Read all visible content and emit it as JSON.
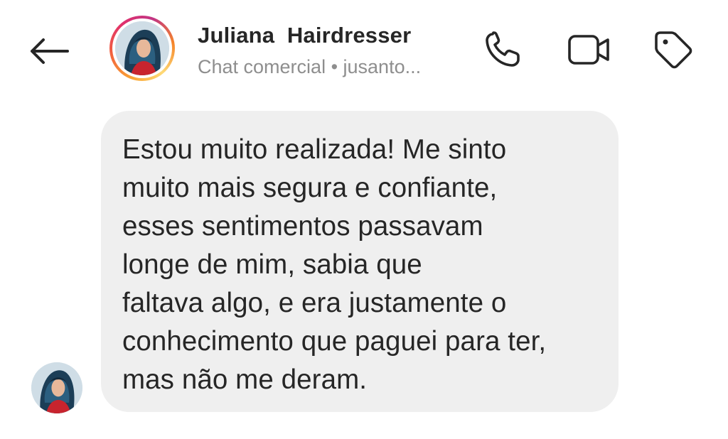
{
  "header": {
    "contact_name": "Juliana  Hairdresser",
    "subtitle": "Chat comercial • jusanto...",
    "back_icon": "arrow-left-icon",
    "phone_icon": "phone-icon",
    "video_icon": "video-camera-icon",
    "tag_icon": "tag-icon",
    "story_ring_colors": [
      "#f9a334",
      "#e1306c",
      "#c13584"
    ]
  },
  "message": {
    "lines": [
      "Estou muito realizada! Me sinto",
      "muito mais segura e confiante,",
      "esses sentimentos passavam",
      "longe de mim, sabia que",
      "faltava algo, e era justamente o",
      "conhecimento que paguei para ter,",
      "mas não me deram."
    ],
    "bubble_color": "#efefef"
  }
}
